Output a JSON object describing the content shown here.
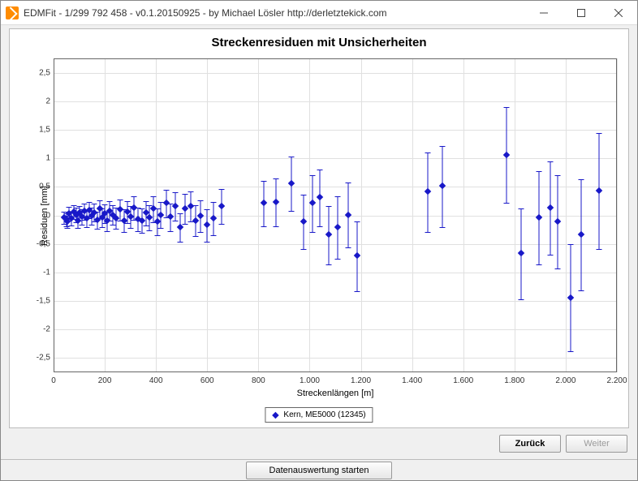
{
  "window": {
    "title": "EDMFit - 1/299 792 458 - v0.1.20150925 - by Michael Lösler http://derletztekick.com"
  },
  "buttons": {
    "back": "Zurück",
    "next": "Weiter",
    "start": "Datenauswertung starten"
  },
  "chart_data": {
    "type": "scatter",
    "title": "Streckenresiduen mit Unsicherheiten",
    "xlabel": "Streckenlängen [m]",
    "ylabel": "Residuen [mm]",
    "xlim": [
      0,
      2200
    ],
    "ylim": [
      -2.75,
      2.75
    ],
    "xticks": [
      0,
      200,
      400,
      600,
      800,
      1000,
      1200,
      1400,
      1600,
      1800,
      2000,
      2200
    ],
    "yticks": [
      -2.5,
      -2.0,
      -1.5,
      -1.0,
      -0.5,
      0.0,
      0.5,
      1.0,
      1.5,
      2.0,
      2.5
    ],
    "legend": "Kern, ME5000 (12345)",
    "series": [
      {
        "name": "Kern, ME5000 (12345)",
        "x": [
          40,
          50,
          55,
          60,
          70,
          80,
          90,
          95,
          100,
          110,
          120,
          130,
          140,
          150,
          160,
          170,
          180,
          190,
          200,
          210,
          220,
          230,
          245,
          260,
          275,
          290,
          300,
          315,
          330,
          345,
          360,
          375,
          390,
          405,
          420,
          440,
          455,
          475,
          495,
          515,
          535,
          555,
          575,
          600,
          625,
          655,
          820,
          870,
          930,
          975,
          1010,
          1040,
          1075,
          1110,
          1150,
          1185,
          1460,
          1520,
          1770,
          1825,
          1895,
          1940,
          1970,
          2020,
          2060,
          2130
        ],
        "y": [
          -0.05,
          -0.08,
          -0.12,
          0.02,
          -0.06,
          0.05,
          0.0,
          -0.1,
          0.03,
          -0.04,
          0.06,
          -0.07,
          0.08,
          -0.02,
          0.04,
          -0.09,
          0.1,
          -0.05,
          0.02,
          -0.11,
          0.07,
          0.0,
          -0.06,
          0.09,
          -0.1,
          0.05,
          -0.03,
          0.12,
          -0.08,
          -0.1,
          0.03,
          -0.05,
          0.1,
          -0.12,
          0.0,
          0.2,
          -0.04,
          0.15,
          -0.22,
          0.1,
          0.15,
          -0.1,
          -0.02,
          -0.18,
          -0.06,
          0.15,
          0.2,
          0.22,
          0.55,
          -0.12,
          0.2,
          0.3,
          -0.35,
          -0.22,
          0.0,
          -0.72,
          0.4,
          0.5,
          1.05,
          -0.68,
          -0.05,
          0.12,
          -0.12,
          -1.45,
          -0.35,
          0.42
        ],
        "err": [
          0.12,
          0.12,
          0.12,
          0.13,
          0.13,
          0.13,
          0.14,
          0.14,
          0.14,
          0.14,
          0.15,
          0.15,
          0.15,
          0.16,
          0.16,
          0.16,
          0.17,
          0.17,
          0.17,
          0.18,
          0.18,
          0.18,
          0.19,
          0.19,
          0.2,
          0.2,
          0.2,
          0.21,
          0.21,
          0.22,
          0.22,
          0.23,
          0.23,
          0.24,
          0.24,
          0.25,
          0.25,
          0.26,
          0.26,
          0.27,
          0.27,
          0.28,
          0.28,
          0.29,
          0.3,
          0.31,
          0.4,
          0.42,
          0.48,
          0.48,
          0.5,
          0.5,
          0.52,
          0.55,
          0.58,
          0.62,
          0.7,
          0.72,
          0.85,
          0.8,
          0.82,
          0.82,
          0.82,
          0.95,
          0.98,
          1.02
        ]
      }
    ]
  }
}
